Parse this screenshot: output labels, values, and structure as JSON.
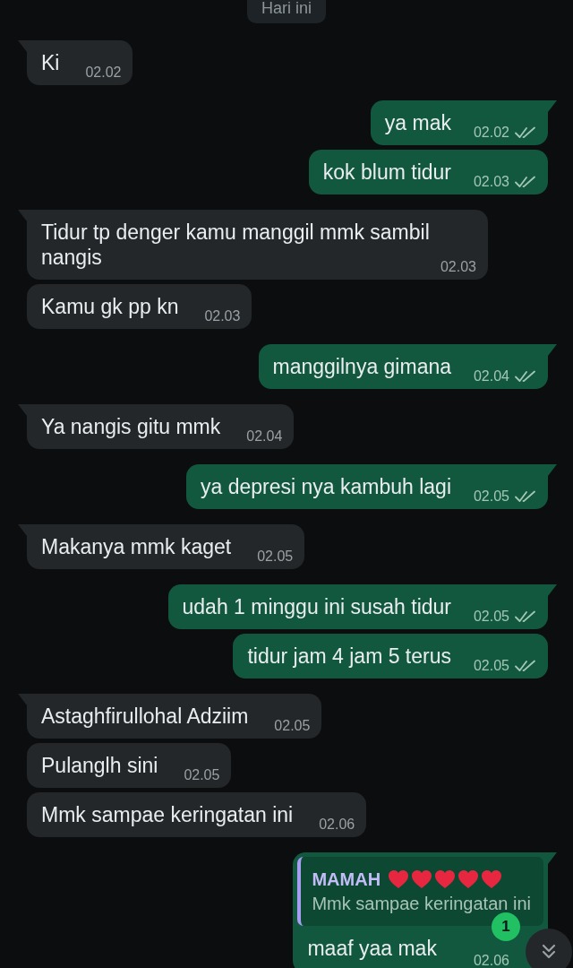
{
  "date_chip": {
    "label": "Hari ini"
  },
  "messages": [
    {
      "kind": "text",
      "outgoing": false,
      "text": "Ki",
      "time": "02.02"
    },
    {
      "kind": "text",
      "outgoing": true,
      "text": "ya mak",
      "time": "02.02",
      "read": false
    },
    {
      "kind": "text",
      "outgoing": true,
      "text": "kok blum tidur",
      "time": "02.03",
      "read": false
    },
    {
      "kind": "text",
      "outgoing": false,
      "text": "Tidur tp denger kamu manggil mmk sambil nangis",
      "time": "02.03"
    },
    {
      "kind": "text",
      "outgoing": false,
      "text": "Kamu gk pp kn",
      "time": "02.03"
    },
    {
      "kind": "text",
      "outgoing": true,
      "text": "manggilnya gimana",
      "time": "02.04",
      "read": false
    },
    {
      "kind": "text",
      "outgoing": false,
      "text": "Ya nangis gitu mmk",
      "time": "02.04"
    },
    {
      "kind": "text",
      "outgoing": true,
      "text": "ya depresi nya kambuh lagi",
      "time": "02.05",
      "read": false
    },
    {
      "kind": "text",
      "outgoing": false,
      "text": "Makanya mmk kaget",
      "time": "02.05"
    },
    {
      "kind": "text",
      "outgoing": true,
      "text": "udah 1 minggu ini susah tidur",
      "time": "02.05",
      "read": false
    },
    {
      "kind": "text",
      "outgoing": true,
      "text": "tidur jam 4 jam 5 terus",
      "time": "02.05",
      "read": false
    },
    {
      "kind": "text",
      "outgoing": false,
      "text": "Astaghfirullohal Adziim",
      "time": "02.05"
    },
    {
      "kind": "text",
      "outgoing": false,
      "text": "Pulanglh sini",
      "time": "02.05"
    },
    {
      "kind": "text",
      "outgoing": false,
      "text": "Mmk sampae keringatan ini",
      "time": "02.06"
    },
    {
      "kind": "reply",
      "outgoing": true,
      "quote": {
        "author": "MAMAH",
        "text": "Mmk sampae keringatan ini"
      },
      "text": "maaf yaa mak",
      "time": "02.06"
    }
  ],
  "scroll_button": {
    "unread_count": "1"
  }
}
